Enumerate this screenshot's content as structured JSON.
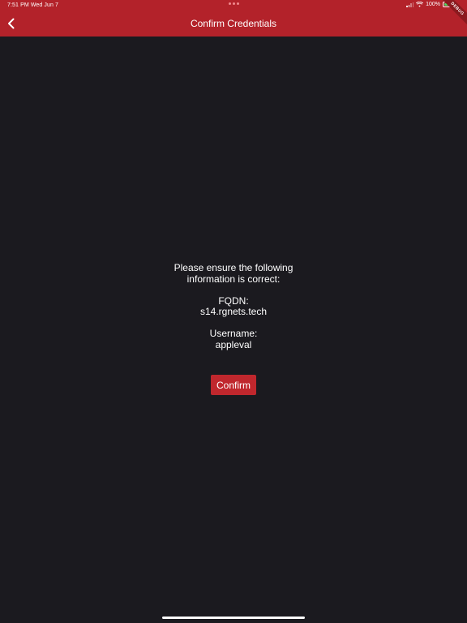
{
  "status_bar": {
    "time_date": "7:51 PM   Wed Jun 7",
    "battery_percent": "100%",
    "debug_label": "DEBUG"
  },
  "app_bar": {
    "title": "Confirm Credentials",
    "back_icon": "chevron-left-icon"
  },
  "content": {
    "intro_line1": "Please ensure the following",
    "intro_line2": "information is correct:",
    "fqdn_label": "FQDN:",
    "fqdn_value": "s14.rgnets.tech",
    "username_label": "Username:",
    "username_value": "appleval"
  },
  "actions": {
    "confirm_label": "Confirm"
  },
  "colors": {
    "accent": "#b3222a",
    "background": "#1b1a1f",
    "button": "#c0272d"
  }
}
